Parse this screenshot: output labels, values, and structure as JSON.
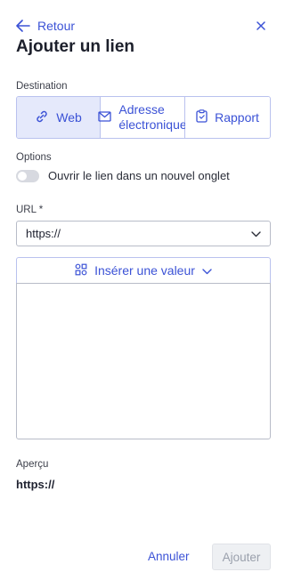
{
  "header": {
    "back_label": "Retour",
    "title": "Ajouter un lien"
  },
  "destination": {
    "label": "Destination",
    "options": [
      {
        "label": "Web",
        "icon": "link-icon",
        "active": true
      },
      {
        "label_line1": "Adresse",
        "label_line2": "électronique",
        "icon": "envelope-icon",
        "active": false
      },
      {
        "label": "Rapport",
        "icon": "clipboard-icon",
        "active": false
      }
    ]
  },
  "options": {
    "label": "Options",
    "new_tab_label": "Ouvrir le lien dans un nouvel onglet",
    "new_tab_enabled": false
  },
  "url": {
    "label": "URL *",
    "protocol": "https://"
  },
  "insert": {
    "label": "Insérer une valeur"
  },
  "preview": {
    "label": "Aperçu",
    "value": "https://"
  },
  "footer": {
    "cancel_label": "Annuler",
    "add_label": "Ajouter"
  },
  "colors": {
    "accent": "#3b52d6",
    "active_bg": "#e5e9fb",
    "border": "#b8bcc8"
  }
}
